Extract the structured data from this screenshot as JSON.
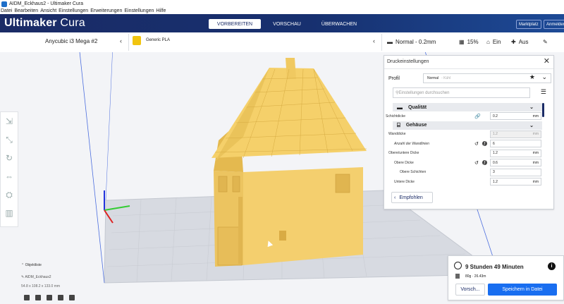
{
  "window": {
    "title": "AIDM_Eckhaus2 - Ultimaker Cura"
  },
  "menu": [
    "Datei",
    "Bearbeiten",
    "Ansicht",
    "Einstellungen",
    "Erweiterungen",
    "Einstellungen",
    "Hilfe"
  ],
  "header": {
    "brand_main": "Ultimaker",
    "brand_sub": "Cura",
    "stages": [
      "VORBEREITEN",
      "VORSCHAU",
      "ÜBERWACHEN"
    ],
    "active_stage": "VORBEREITEN",
    "marketplace": "Marktplatz",
    "signin": "Anmelden"
  },
  "toolbar": {
    "machine": "Anycubic i3 Mega #2",
    "material": "Generic PLA",
    "profile": "Normal - 0.2mm",
    "infill": "15%",
    "support": "Ein",
    "adhesion": "Aus"
  },
  "print_settings": {
    "title": "Druckeinstellungen",
    "profile_label": "Profil",
    "profile_value": "Normal",
    "profile_suffix": "- Kühl",
    "search_placeholder": "Einstellungen durchsuchen",
    "recommended": "Empfohlen",
    "categories": [
      {
        "name": "Qualität",
        "rows": [
          {
            "label": "Schichtdicke",
            "value": "0.2",
            "unit": "mm",
            "link": true
          }
        ]
      },
      {
        "name": "Gehäuse",
        "rows": [
          {
            "label": "Wanddicke",
            "value": "1.2",
            "unit": "mm",
            "disabled": true
          },
          {
            "label": "Anzahl der Wandlinien",
            "value": "6",
            "unit": "",
            "reset": true,
            "italic": true
          },
          {
            "label": "Obere/untere Dicke",
            "value": "1.2",
            "unit": "mm"
          },
          {
            "label": "Obere Dicke",
            "value": "0.6",
            "unit": "mm",
            "reset": true
          },
          {
            "label": "Obere Schichten",
            "value": "3",
            "unit": ""
          },
          {
            "label": "Untere Dicke",
            "value": "1.2",
            "unit": "mm"
          }
        ]
      }
    ]
  },
  "object_list": {
    "title": "Objektliste",
    "name": "AIDM_Eckhaus2",
    "dims": "54.8 x 108.2 x 133.0 mm"
  },
  "output": {
    "time": "9 Stunden 49 Minuten",
    "material": "80g · 26.43m",
    "preview": "Vorsch...",
    "save": "Speichern in Datei"
  },
  "colors": {
    "header": "#1a2b66",
    "accent": "#196ef0",
    "model": "#f4cf6e",
    "material": "#f1c40f"
  }
}
